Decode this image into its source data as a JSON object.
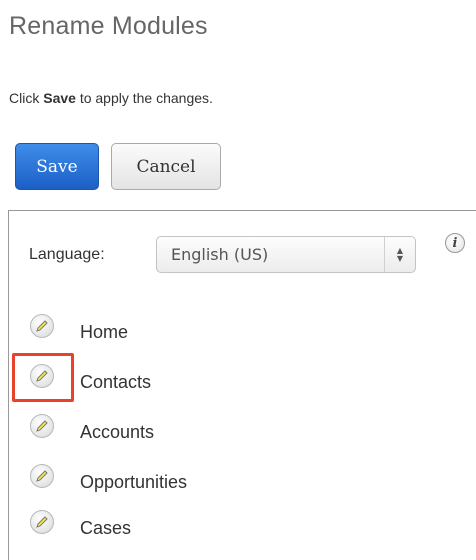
{
  "page": {
    "title": "Rename Modules",
    "instructions": {
      "prefix": "Click ",
      "bold": "Save",
      "suffix": " to apply the changes."
    }
  },
  "buttons": {
    "save": "Save",
    "cancel": "Cancel"
  },
  "language": {
    "label": "Language:",
    "selected": "English (US)",
    "info_glyph": "i"
  },
  "modules": [
    {
      "label": "Home",
      "icon": "pencil-icon"
    },
    {
      "label": "Contacts",
      "icon": "pencil-icon",
      "highlighted": true
    },
    {
      "label": "Accounts",
      "icon": "pencil-icon"
    },
    {
      "label": "Opportunities",
      "icon": "pencil-icon"
    },
    {
      "label": "Cases",
      "icon": "pencil-icon"
    }
  ],
  "colors": {
    "save_button": "#2a73d9",
    "highlight": "#e8412c",
    "pencil": "#f2e84a"
  }
}
